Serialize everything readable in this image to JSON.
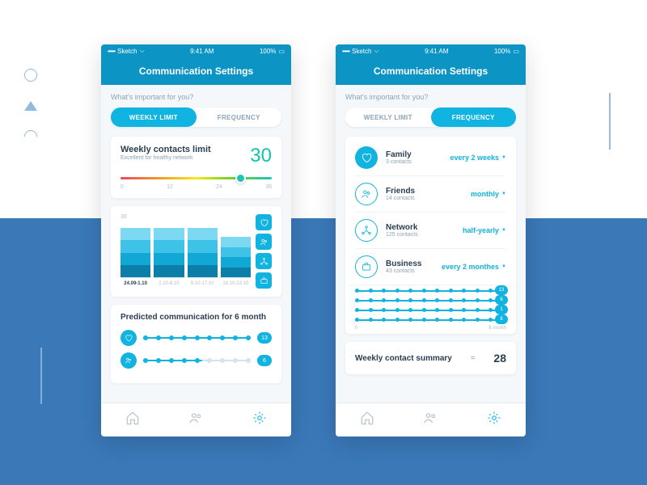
{
  "status": {
    "carrier": "Sketch",
    "time": "9:41 AM",
    "battery": "100%"
  },
  "header": {
    "title": "Communication Settings"
  },
  "prompt": "What's important for you?",
  "tabs": {
    "weekly": "WEEKLY LIMIT",
    "frequency": "FREQUENCY"
  },
  "limit": {
    "title": "Weekly contacts limit",
    "subtitle": "Excellent for healthy network",
    "value": "30",
    "ticks": [
      "0",
      "12",
      "24",
      "36"
    ],
    "thumb_pct": 76
  },
  "chart_data": {
    "type": "bar",
    "ylim": [
      0,
      30
    ],
    "ylabel": "30",
    "categories": [
      "24.09-1.10",
      "2.10-8.10",
      "9.10-17.10",
      "18.10-23.10"
    ],
    "active_category": 0,
    "series": [
      {
        "name": "Family",
        "values": [
          7,
          7,
          7,
          6
        ]
      },
      {
        "name": "Friends",
        "values": [
          7,
          7,
          7,
          6
        ]
      },
      {
        "name": "Network",
        "values": [
          7,
          7,
          7,
          6
        ]
      },
      {
        "name": "Business",
        "values": [
          6,
          6,
          6,
          5
        ]
      }
    ],
    "side_icons": [
      "heart-icon",
      "people-icon",
      "network-icon",
      "briefcase-icon"
    ]
  },
  "predicted": {
    "title": "Predicted communication for 6 month",
    "rows": [
      {
        "icon": "heart-icon",
        "value": "13",
        "fill_pct": 100,
        "dots": 9
      },
      {
        "icon": "people-icon",
        "value": "6",
        "fill_pct": 55,
        "dots": 9
      }
    ]
  },
  "categories": [
    {
      "icon": "heart-icon",
      "name": "Family",
      "count": "3 contacts",
      "freq": "every 2 weeks",
      "outline": false
    },
    {
      "icon": "people-icon",
      "name": "Friends",
      "count": "14 contacts",
      "freq": "monthly",
      "outline": true
    },
    {
      "icon": "network-icon",
      "name": "Network",
      "count": "125 contacts",
      "freq": "half-yearly",
      "outline": true
    },
    {
      "icon": "briefcase-icon",
      "name": "Business",
      "count": "43 contacts",
      "freq": "every 2 monthes",
      "outline": true
    }
  ],
  "freq_chart": {
    "rows": [
      {
        "value": "13",
        "fill_pct": 100
      },
      {
        "value": "6",
        "fill_pct": 100
      },
      {
        "value": "1",
        "fill_pct": 100
      },
      {
        "value": "8",
        "fill_pct": 100
      }
    ],
    "axis": {
      "start": "0",
      "end": "6 month"
    }
  },
  "summary": {
    "title": "Weekly contact summary",
    "value": "28"
  }
}
